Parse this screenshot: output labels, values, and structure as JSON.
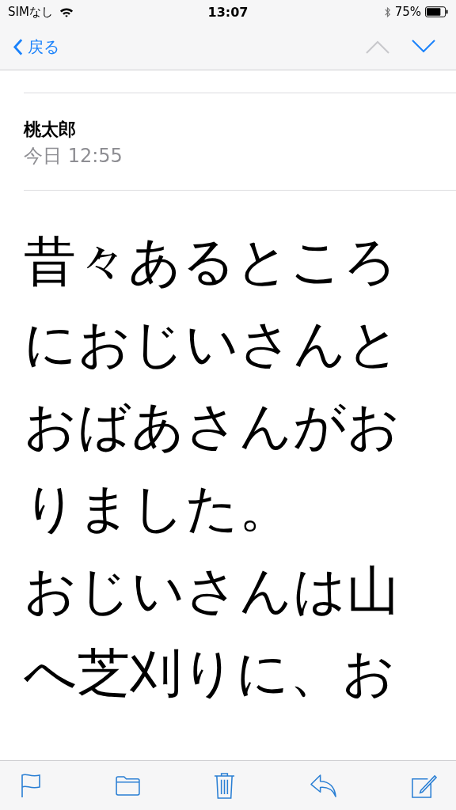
{
  "status_bar": {
    "carrier": "SIMなし",
    "time": "13:07",
    "battery": "75%"
  },
  "nav_bar": {
    "back": "戻る",
    "previous": {
      "disabled": true
    },
    "next": {
      "disabled": false
    }
  },
  "message": {
    "sender": "桃太郎",
    "date": "今日 12:55"
  },
  "body": [
    "昔々あるところにおじいさんとおばあさんがおりました。",
    "おじいさんは山へ芝刈りに、お"
  ]
}
